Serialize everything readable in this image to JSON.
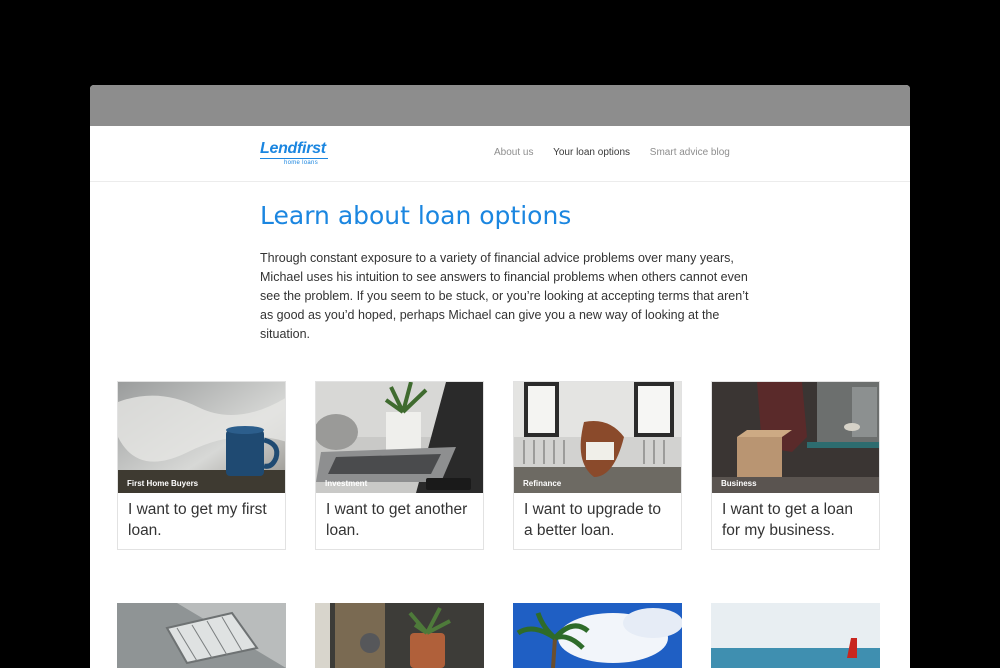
{
  "brand": {
    "name": "Lendfirst",
    "tagline": "home loans"
  },
  "nav": {
    "items": [
      {
        "label": "About us",
        "active": false
      },
      {
        "label": "Your loan options",
        "active": true
      },
      {
        "label": "Smart advice blog",
        "active": false
      }
    ]
  },
  "main": {
    "title": "Learn about loan options",
    "intro": "Through constant exposure to a variety of financial advice problems over many years, Michael uses his intuition to see answers to financial problems when others cannot even see the problem. If you seem to be stuck, or you’re looking at accepting terms that aren’t as good as you’d hoped, perhaps Michael can give you a new way of looking at the situation."
  },
  "cards": [
    {
      "tag": "First Home Buyers",
      "text": "I want to get my first loan."
    },
    {
      "tag": "Investment",
      "text": "I want to get another loan."
    },
    {
      "tag": "Refinance",
      "text": "I want to upgrade to a better loan."
    },
    {
      "tag": "Business",
      "text": "I want to get a loan for my business."
    }
  ],
  "colors": {
    "accent": "#1b86e0",
    "backdrop": "#000000",
    "titlebar": "#8d8d8d"
  }
}
